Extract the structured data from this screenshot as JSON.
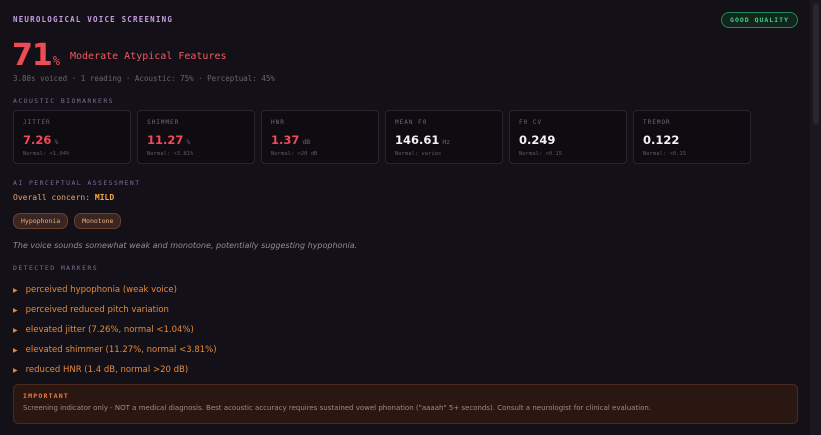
{
  "header": {
    "title": "Neurological Voice Screening",
    "quality_badge": "GOOD QUALITY"
  },
  "score": {
    "value": "71",
    "unit": "%",
    "label": "Moderate Atypical Features"
  },
  "meta": "3.80s voiced · 1 reading · Acoustic: 75% · Perceptual: 45%",
  "acoustic": {
    "section_label": "Acoustic Biomarkers",
    "cards": [
      {
        "label": "Jitter",
        "value": "7.26",
        "unit": "%",
        "normal": "Normal: <1.04%",
        "color": "#f04a55"
      },
      {
        "label": "Shimmer",
        "value": "11.27",
        "unit": "%",
        "normal": "Normal: <3.81%",
        "color": "#f04a55"
      },
      {
        "label": "HNR",
        "value": "1.37",
        "unit": "dB",
        "normal": "Normal: >20 dB",
        "color": "#f04a55"
      },
      {
        "label": "Mean F0",
        "value": "146.61",
        "unit": "Hz",
        "normal": "Normal: varies",
        "color": "#f2f2f5"
      },
      {
        "label": "F0 CV",
        "value": "0.249",
        "unit": "",
        "normal": "Normal: <0.15",
        "color": "#f2f2f5"
      },
      {
        "label": "Tremor",
        "value": "0.122",
        "unit": "",
        "normal": "Normal: <0.15",
        "color": "#f2f2f5"
      }
    ]
  },
  "perceptual": {
    "section_label": "AI Perceptual Assessment",
    "concern_label": "Overall concern:",
    "concern_value": "MILD",
    "tags": [
      "Hypophonia",
      "Monotone"
    ],
    "description": "The voice sounds somewhat weak and monotone, potentially suggesting hypophonia."
  },
  "markers": {
    "section_label": "Detected Markers",
    "items": [
      "perceived hypophonia (weak voice)",
      "perceived reduced pitch variation",
      "elevated jitter (7.26%, normal <1.04%)",
      "elevated shimmer (11.27%, normal <3.81%)",
      "reduced HNR (1.4 dB, normal >20 dB)"
    ]
  },
  "notice": {
    "title": "Important",
    "text": "Screening indicator only - NOT a medical diagnosis. Best acoustic accuracy requires sustained vowel phonation (\"aaaah\" 5+ seconds). Consult a neurologist for clinical evaluation."
  }
}
